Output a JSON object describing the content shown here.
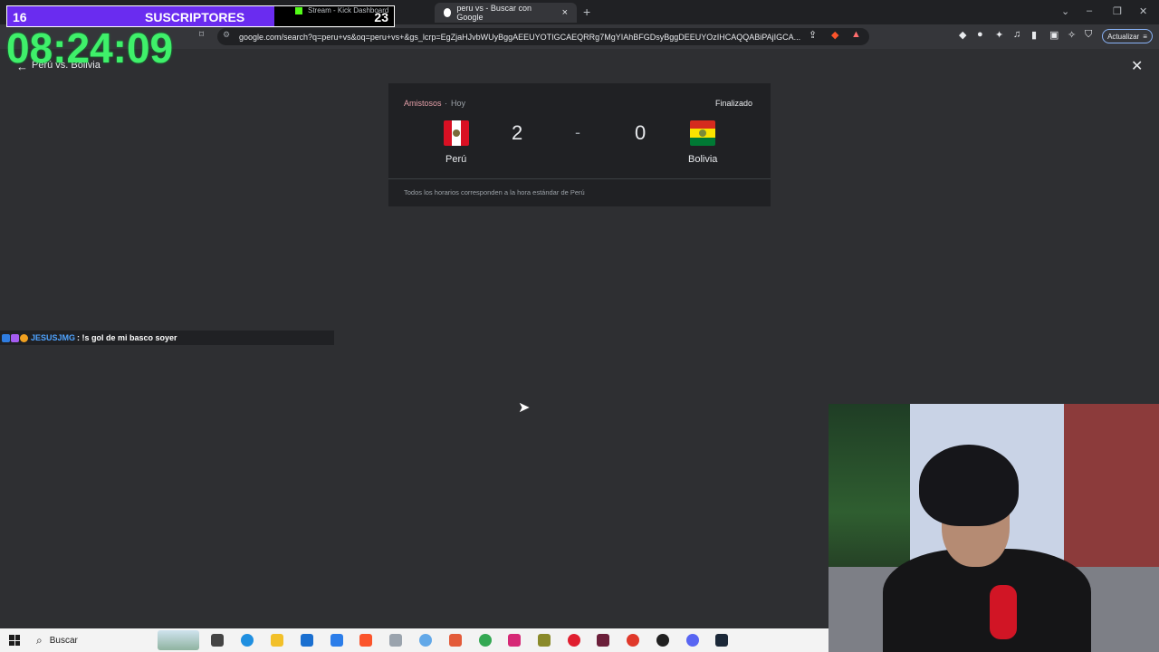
{
  "browser": {
    "tabs": [
      {
        "title": "Stream - Kick Dashboard"
      },
      {
        "title": "peru vs - Buscar con Google",
        "close": "×"
      }
    ],
    "new_tab": "+",
    "url": "google.com/search?q=peru+vs&oq=peru+vs+&gs_lcrp=EgZjaHJvbWUyBggAEEUYOTIGCAEQRRg7MgYIAhBFGDsyBggDEEUYOzIHCAQQABiPAjIGCA...",
    "update_label": "Actualizar"
  },
  "page": {
    "back_icon": "←",
    "title": "Perú vs. Bolivia",
    "close_icon": "✕"
  },
  "match": {
    "competition": "Amistosos",
    "separator": "·",
    "day": "Hoy",
    "status": "Finalizado",
    "home": {
      "name": "Perú",
      "score": "2",
      "flag_colors": [
        "#d91023",
        "#ffffff",
        "#d91023"
      ]
    },
    "away": {
      "name": "Bolivia",
      "score": "0",
      "flag_colors": [
        "#d52b1e",
        "#f9e300",
        "#007934"
      ]
    },
    "dash": "-",
    "footnote": "Todos los horarios corresponden a la hora estándar de Perú"
  },
  "overlay": {
    "subs_current": "16",
    "subs_label": "SUSCRIPTORES",
    "subs_goal": "23",
    "clock": "08:24:09",
    "chat": {
      "user": "JESUSJMG",
      "message": ": !s gol de mi basco soyer"
    }
  },
  "taskbar": {
    "search_label": "Buscar"
  },
  "colors": {
    "accent_purple": "#6a2cf0",
    "clock_green": "#3ff06a",
    "chat_user": "#4fa3ff"
  }
}
